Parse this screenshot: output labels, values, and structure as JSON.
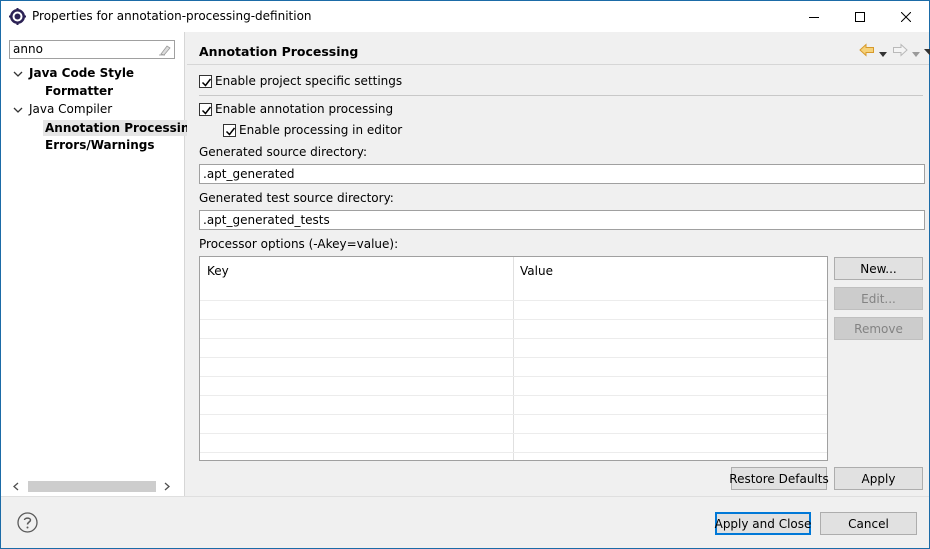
{
  "window": {
    "title": "Properties for annotation-processing-definition",
    "minimize_icon": "minimize-icon",
    "maximize_icon": "maximize-icon",
    "close_icon": "close-icon"
  },
  "sidebar": {
    "filter_value": "anno",
    "tree": [
      {
        "label": "Java Code Style",
        "expanded": true,
        "bold": true
      },
      {
        "label": "Formatter",
        "bold": true
      },
      {
        "label": "Java Compiler",
        "expanded": true,
        "bold": false
      },
      {
        "label": "Annotation Processing",
        "bold": true,
        "selected": true
      },
      {
        "label": "Errors/Warnings",
        "bold": true
      }
    ]
  },
  "page": {
    "title": "Annotation Processing",
    "enable_project_specific": {
      "label": "Enable project specific settings",
      "checked": true
    },
    "enable_annotation_processing": {
      "label": "Enable annotation processing",
      "checked": true
    },
    "enable_processing_in_editor": {
      "label": "Enable processing in editor",
      "checked": true
    },
    "generated_source_dir": {
      "label": "Generated source directory:",
      "value": ".apt_generated"
    },
    "generated_test_source_dir": {
      "label": "Generated test source directory:",
      "value": ".apt_generated_tests"
    },
    "processor_options_label": "Processor options (-Akey=value):",
    "table": {
      "columns": [
        "Key",
        "Value"
      ],
      "rows": []
    },
    "buttons": {
      "new": "New...",
      "edit": "Edit...",
      "remove": "Remove",
      "restore_defaults": "Restore Defaults",
      "apply": "Apply"
    }
  },
  "footer": {
    "apply_and_close": "Apply and Close",
    "cancel": "Cancel"
  },
  "colors": {
    "accent": "#0078d7",
    "nav_back_arrow": "#e8a33a"
  }
}
